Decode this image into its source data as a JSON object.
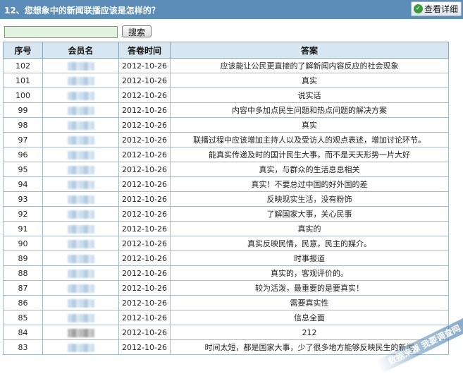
{
  "header": {
    "question_title": "12、您想象中的新闻联播应该是怎样的？",
    "detail_button_label": "查看详细",
    "detail_icon": "view-icon"
  },
  "search": {
    "value": "",
    "button_label": "搜索"
  },
  "table": {
    "columns": [
      "序号",
      "会员名",
      "答卷时间",
      "答案"
    ],
    "rows": [
      {
        "id": "102",
        "member": "",
        "time": "2012-10-26",
        "answer": "应该能让公民更直接的了解新闻内容反应的社会现象"
      },
      {
        "id": "101",
        "member": "",
        "time": "2012-10-26",
        "answer": "真实"
      },
      {
        "id": "100",
        "member": "",
        "time": "2012-10-26",
        "answer": "说实话"
      },
      {
        "id": "99",
        "member": "",
        "time": "2012-10-26",
        "answer": "内容中多加点民生问题和热点问题的解决方案"
      },
      {
        "id": "98",
        "member": "",
        "time": "2012-10-26",
        "answer": "真实"
      },
      {
        "id": "97",
        "member": "",
        "time": "2012-10-26",
        "answer": "联播过程中应该增加主持人以及受访人的观点表述，增加讨论环节。"
      },
      {
        "id": "96",
        "member": "",
        "time": "2012-10-26",
        "answer": "能真实传递及时的国计民生大事，而不是天天形势一片大好"
      },
      {
        "id": "95",
        "member": "",
        "time": "2012-10-26",
        "answer": "真实，与群众的生活息息相关"
      },
      {
        "id": "94",
        "member": "",
        "time": "2012-10-26",
        "answer": "真实！不要总过中国的好外国的差"
      },
      {
        "id": "93",
        "member": "",
        "time": "2012-10-26",
        "answer": "反映现实生活，没有粉饰"
      },
      {
        "id": "92",
        "member": "",
        "time": "2012-10-26",
        "answer": "了解国家大事，关心民事"
      },
      {
        "id": "91",
        "member": "",
        "time": "2012-10-26",
        "answer": "真实的"
      },
      {
        "id": "90",
        "member": "",
        "time": "2012-10-26",
        "answer": "真实反映民情，民意，民主的媒介。"
      },
      {
        "id": "89",
        "member": "",
        "time": "2012-10-26",
        "answer": "时事报道"
      },
      {
        "id": "88",
        "member": "",
        "time": "2012-10-26",
        "answer": "真实的，客观评价的。"
      },
      {
        "id": "87",
        "member": "",
        "time": "2012-10-26",
        "answer": "较为活泼，最重要的是要真实！"
      },
      {
        "id": "86",
        "member": "",
        "time": "2012-10-26",
        "answer": "需要真实性"
      },
      {
        "id": "85",
        "member": "",
        "time": "2012-10-26",
        "answer": "信息全面"
      },
      {
        "id": "84",
        "member": "",
        "time": "2012-10-26",
        "answer": "212"
      },
      {
        "id": "83",
        "member": "",
        "time": "2012-10-26",
        "answer": "时间太短，都是国家大事，少了很多地方能够反映民生的新闻"
      }
    ]
  },
  "watermark": {
    "text": "数据来源 我要调查网"
  },
  "colors": {
    "header_bg": "#5b8db8",
    "table_header_bg": "#d8e6f1",
    "border": "#a7b9ca",
    "search_input_bg": "#e3f3e1"
  }
}
